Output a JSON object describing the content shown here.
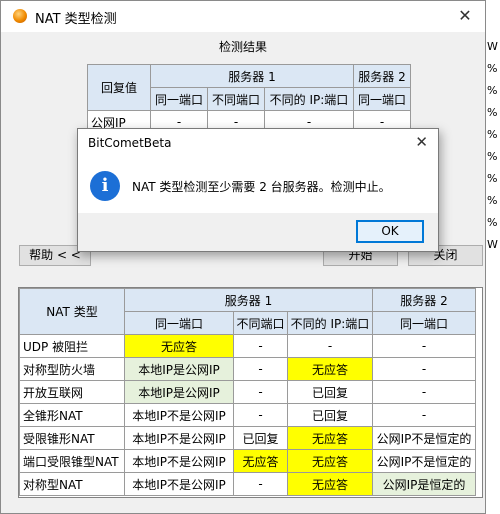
{
  "window": {
    "title": "NAT 类型检测"
  },
  "results": {
    "title": "检测结果",
    "header_reply": "回复值",
    "server1": "服务器 1",
    "server2": "服务器 2",
    "sub": [
      "同一端口",
      "不同端口",
      "不同的 IP:端口",
      "同一端口"
    ],
    "row": {
      "label": "公网IP",
      "values": [
        "-",
        "-",
        "-",
        "-"
      ]
    }
  },
  "buttons": {
    "help": "帮助 < <",
    "start": "开始",
    "close": "关闭"
  },
  "nat_table": {
    "header_type": "NAT 类型",
    "server1": "服务器 1",
    "server2": "服务器 2",
    "sub": [
      "同一端口",
      "不同端口",
      "不同的 IP:端口",
      "同一端口"
    ],
    "rows": [
      {
        "type": "UDP 被阻拦",
        "cells": [
          "无应答",
          "-",
          "-",
          "-"
        ]
      },
      {
        "type": "对称型防火墙",
        "cells": [
          "本地IP是公网IP",
          "-",
          "无应答",
          "-"
        ]
      },
      {
        "type": "开放互联网",
        "cells": [
          "本地IP是公网IP",
          "-",
          "已回复",
          "-"
        ]
      },
      {
        "type": "全锥形NAT",
        "cells": [
          "本地IP不是公网IP",
          "-",
          "已回复",
          "-"
        ]
      },
      {
        "type": "受限锥形NAT",
        "cells": [
          "本地IP不是公网IP",
          "已回复",
          "无应答",
          "公网IP不是恒定的"
        ]
      },
      {
        "type": "端口受限锥型NAT",
        "cells": [
          "本地IP不是公网IP",
          "无应答",
          "无应答",
          "公网IP不是恒定的"
        ]
      },
      {
        "type": "对称型NAT",
        "cells": [
          "本地IP不是公网IP",
          "-",
          "无应答",
          "公网IP是恒定的"
        ]
      }
    ]
  },
  "dialog": {
    "title": "BitCometBeta",
    "message": "NAT 类型检测至少需要 2 台服务器。检测中止。",
    "ok": "OK",
    "icon": "info-icon"
  },
  "colors": {
    "highlight": "#ffff00",
    "green": "#e6f1dc",
    "header": "#dbe7f4",
    "accent": "#0078d7"
  }
}
